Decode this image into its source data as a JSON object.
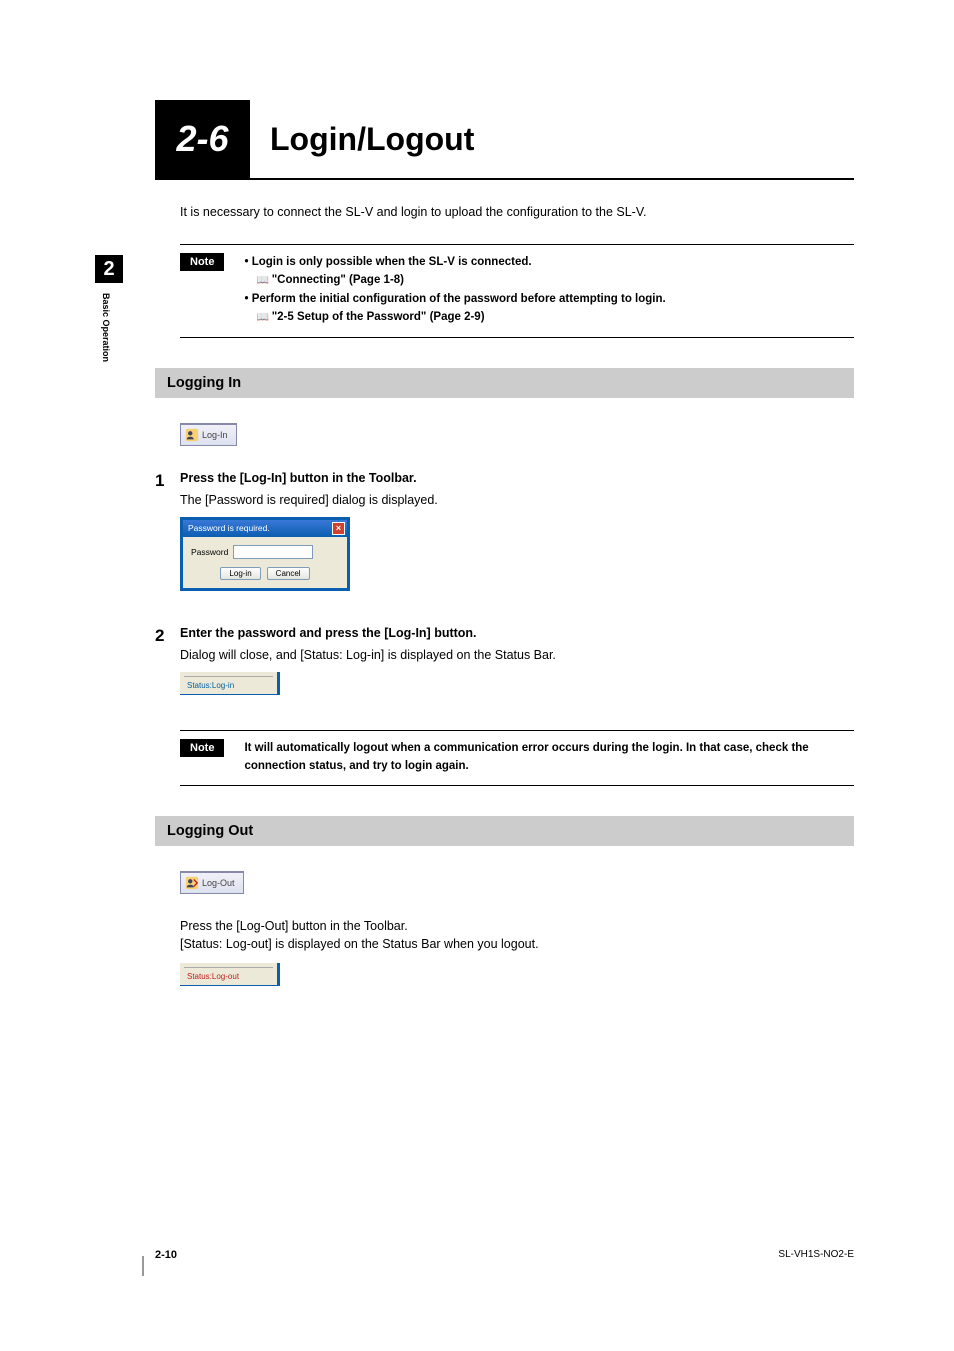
{
  "side": {
    "chapter_num": "2",
    "label": "Basic Operation"
  },
  "header": {
    "section_num": "2-6",
    "title": "Login/Logout"
  },
  "intro": "It is necessary to connect the SL-V and login to upload the configuration to the SL-V.",
  "note1": {
    "badge": "Note",
    "b1": "Login is only possible when the SL-V is connected.",
    "r1": "\"Connecting\" (Page 1-8)",
    "b2": "Perform the initial configuration of the password before attempting to login.",
    "r2": "\"2-5 Setup of the Password\" (Page 2-9)"
  },
  "section_login": "Logging In",
  "login_btn_label": "Log-In",
  "step1": {
    "num": "1",
    "title": "Press the [Log-In] button in the Toolbar.",
    "desc": "The [Password is required] dialog is displayed."
  },
  "dialog": {
    "title": "Password is required.",
    "close": "×",
    "field_label": "Password",
    "btn_login": "Log-in",
    "btn_cancel": "Cancel"
  },
  "step2": {
    "num": "2",
    "title": "Enter the password and press the [Log-In] button.",
    "desc": "Dialog will close, and [Status: Log-in] is displayed on the Status Bar."
  },
  "status_login": "Status:Log-in",
  "note2": {
    "badge": "Note",
    "text": "It will automatically logout when a communication error occurs during the login. In that case, check the connection status, and try to login again."
  },
  "section_logout": "Logging Out",
  "logout_btn_label": "Log-Out",
  "logout_text1": "Press the [Log-Out] button in the Toolbar.",
  "logout_text2": "[Status: Log-out] is displayed on the Status Bar when you logout.",
  "status_logout": "Status:Log-out",
  "footer": {
    "page": "2-10",
    "doc": "SL-VH1S-NO2-E"
  }
}
